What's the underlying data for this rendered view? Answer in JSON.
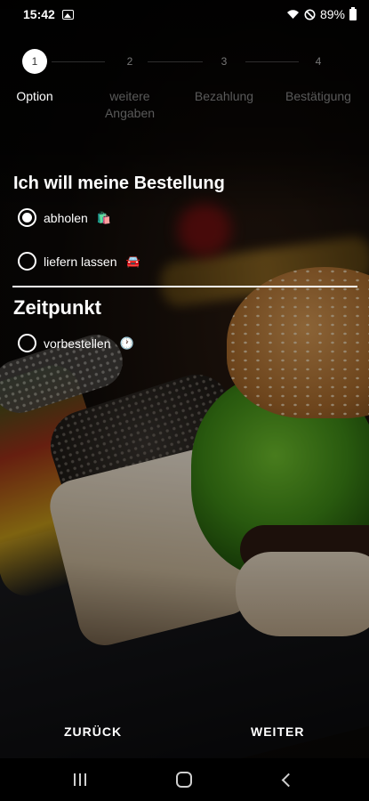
{
  "status_bar": {
    "time": "15:42",
    "battery": "89%",
    "icons": [
      "photo-icon",
      "wifi-icon",
      "do-not-disturb-icon",
      "battery-icon"
    ]
  },
  "stepper": {
    "steps": [
      {
        "number": "1",
        "label": "Option",
        "active": true
      },
      {
        "number": "2",
        "label": "weitere Angaben",
        "active": false
      },
      {
        "number": "3",
        "label": "Bezahlung",
        "active": false
      },
      {
        "number": "4",
        "label": "Bestätigung",
        "active": false
      }
    ]
  },
  "order": {
    "title": "Ich will meine Bestellung",
    "options": [
      {
        "label": "abholen",
        "emoji": "🛍️",
        "checked": true
      },
      {
        "label": "liefern lassen",
        "emoji": "🚘",
        "checked": false
      }
    ]
  },
  "time": {
    "title": "Zeitpunkt",
    "options": [
      {
        "label": "vorbestellen",
        "emoji": "🕐",
        "checked": false
      }
    ]
  },
  "actions": {
    "back_label": "ZURÜCK",
    "next_label": "WEITER"
  },
  "colors": {
    "background": "#000000",
    "text": "#ffffff",
    "inactive_step": "#5a5a5a"
  }
}
